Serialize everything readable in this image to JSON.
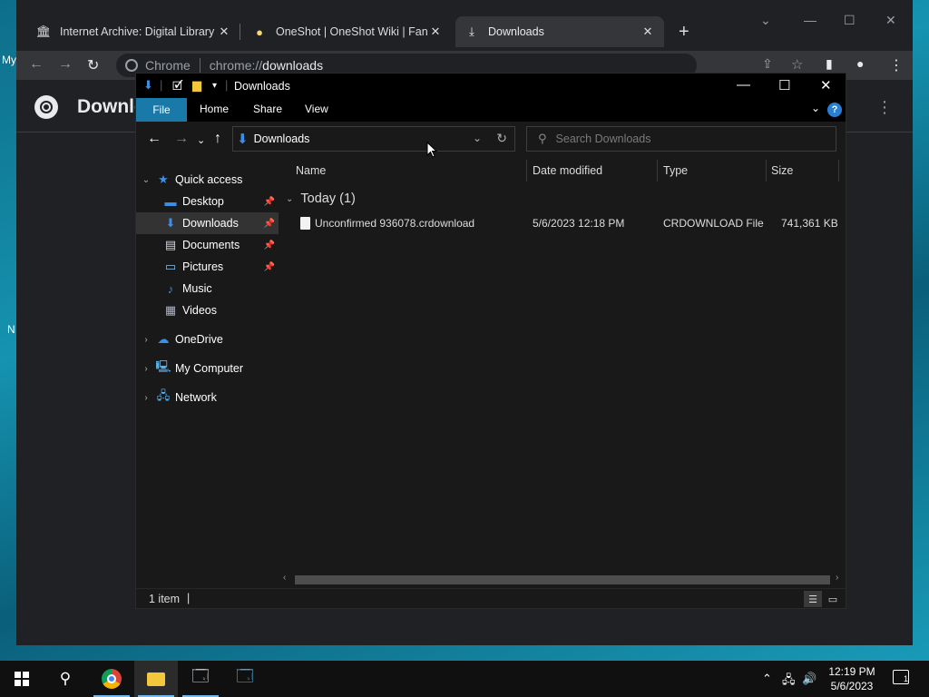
{
  "desktop": {
    "frag_my": "My",
    "frag_n": "N"
  },
  "chrome": {
    "tabs": [
      {
        "title": "Internet Archive: Digital Library of Free & Borrowable Books",
        "icon": "archive-icon"
      },
      {
        "title": "OneShot | OneShot Wiki | Fandom",
        "icon": "sun-icon"
      },
      {
        "title": "Downloads",
        "icon": "download-icon"
      }
    ],
    "new_tab": "+",
    "omnibox": {
      "label": "Chrome",
      "scheme": "chrome://",
      "host": "downloads"
    },
    "page_title": "Downloads"
  },
  "explorer": {
    "title": "Downloads",
    "ribbon_tabs": [
      "File",
      "Home",
      "Share",
      "View"
    ],
    "help": "?",
    "address": "Downloads",
    "search_placeholder": "Search Downloads",
    "nav": {
      "quick_access": "Quick access",
      "desktop": "Desktop",
      "downloads": "Downloads",
      "documents": "Documents",
      "pictures": "Pictures",
      "music": "Music",
      "videos": "Videos",
      "onedrive": "OneDrive",
      "my_computer": "My Computer",
      "network": "Network"
    },
    "columns": {
      "name": "Name",
      "date": "Date modified",
      "type": "Type",
      "size": "Size"
    },
    "group": "Today (1)",
    "files": [
      {
        "name": "Unconfirmed 936078.crdownload",
        "date": "5/6/2023 12:18 PM",
        "type": "CRDOWNLOAD File",
        "size": "741,361 KB"
      }
    ],
    "status": "1 item"
  },
  "taskbar": {
    "time": "12:19 PM",
    "date": "5/6/2023",
    "notifications": "1"
  }
}
